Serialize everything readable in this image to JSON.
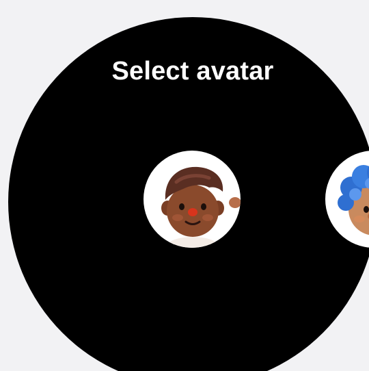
{
  "screen": {
    "title": "Select avatar"
  },
  "avatars": [
    {
      "name": "avatar-boy-brown-hair",
      "state": "selected"
    },
    {
      "name": "avatar-blue-curly-hair",
      "state": "next"
    }
  ],
  "colors": {
    "background": "#f2f2f4",
    "watch_face": "#000000",
    "text": "#ffffff",
    "avatar_ring": "#ffffff"
  }
}
